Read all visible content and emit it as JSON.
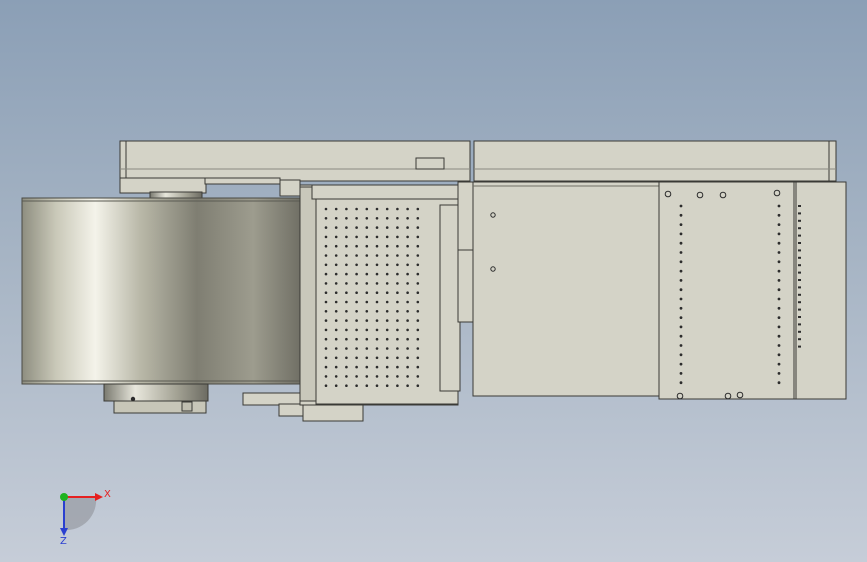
{
  "viewport": {
    "background_top": "#8b9fb6",
    "background_bottom": "#c6cdd8"
  },
  "model": {
    "part_fill": "#d4d3c7",
    "part_stroke": "#3a3a36",
    "hole_color": "#2c2c2c"
  },
  "triad": {
    "x_label": "X",
    "z_label": "Z",
    "x_color": "#e52020",
    "y_color": "#1fb31f",
    "z_color": "#2a3fd0"
  }
}
